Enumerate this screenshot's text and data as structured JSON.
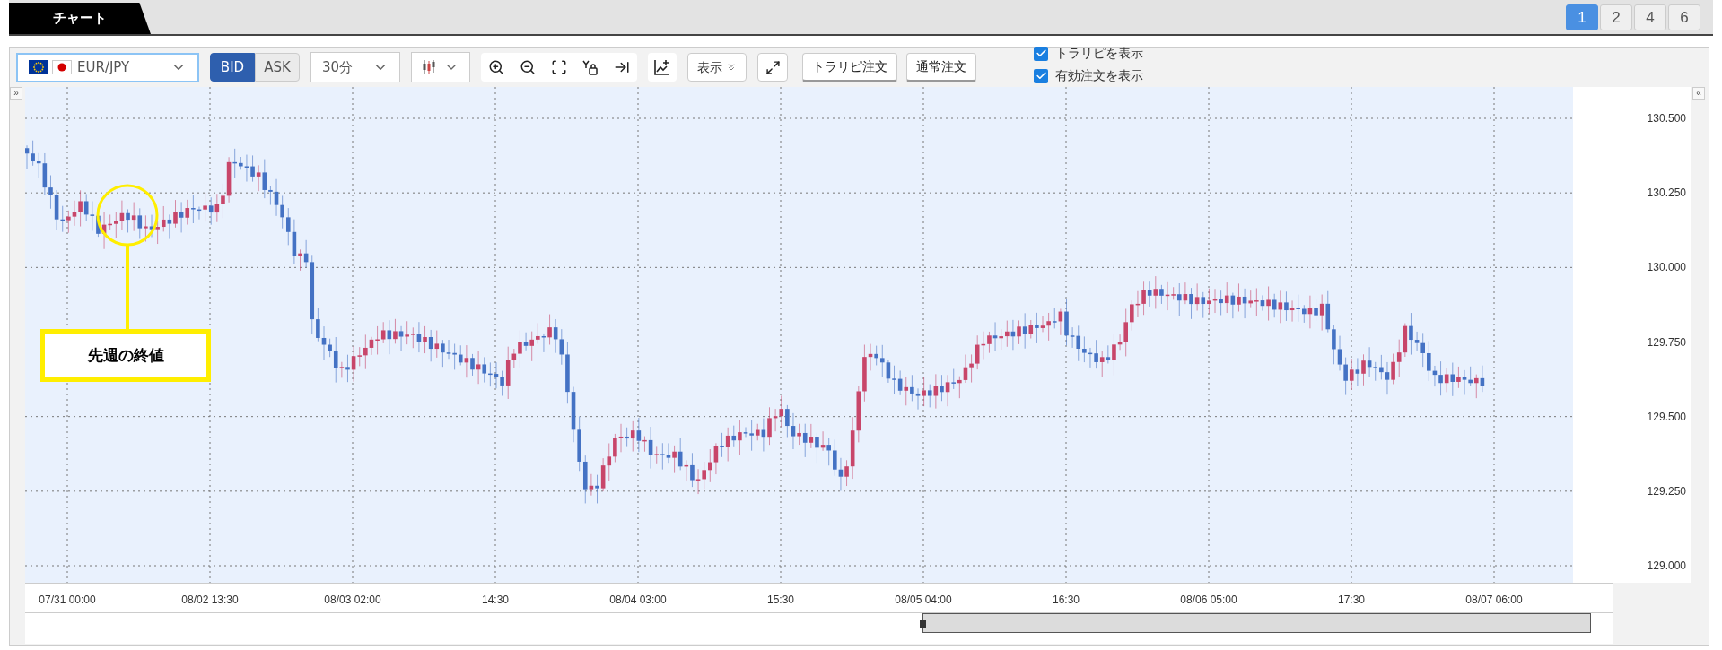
{
  "tab": {
    "label": "チャート"
  },
  "layouts": [
    {
      "label": "1",
      "selected": true
    },
    {
      "label": "2",
      "selected": false
    },
    {
      "label": "4",
      "selected": false
    },
    {
      "label": "6",
      "selected": false
    }
  ],
  "toolbar": {
    "pair": "EUR/JPY",
    "price_types": [
      {
        "label": "BID",
        "selected": true
      },
      {
        "label": "ASK",
        "selected": false
      }
    ],
    "interval": "30分",
    "display_menu": "表示",
    "order_buttons": [
      "トラリピ注文",
      "通常注文"
    ],
    "checkboxes": [
      {
        "label": "トラリピを表示",
        "checked": true
      },
      {
        "label": "有効注文を表示",
        "checked": true
      }
    ]
  },
  "chart": {
    "expand_left": "»",
    "expand_right": "«",
    "y_axis": [
      "130.500",
      "130.250",
      "130.000",
      "129.750",
      "129.500",
      "129.250",
      "129.000"
    ],
    "x_axis": [
      "07/31 00:00",
      "08/02 13:30",
      "08/03 02:00",
      "14:30",
      "08/04 03:00",
      "15:30",
      "08/05 04:00",
      "16:30",
      "08/06 05:00",
      "17:30",
      "08/07 06:00"
    ],
    "callout": "先週の終値"
  }
}
